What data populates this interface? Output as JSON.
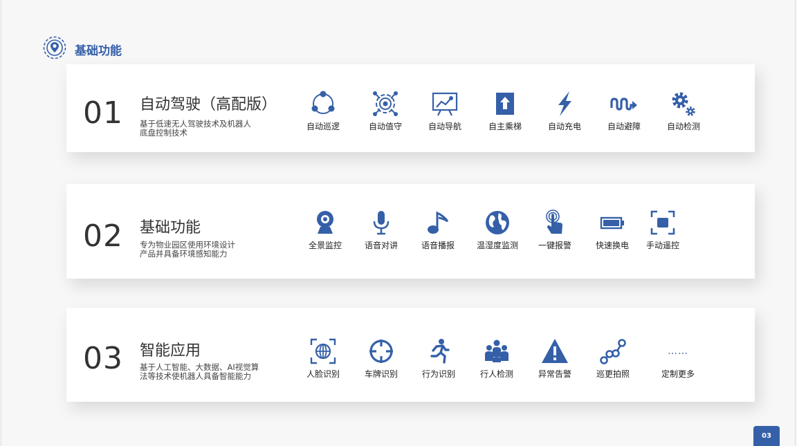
{
  "header": {
    "title": "基础功能",
    "icon": "location-target-icon"
  },
  "colors": {
    "accent": "#3560a8",
    "card_bg": "#ffffff",
    "page_bg": "#f7f7f8"
  },
  "sections": [
    {
      "num": "01",
      "title": "自动驾驶（高配版）",
      "desc_lines": [
        "基于低速无人驾驶技术及机器人",
        "底盘控制技术"
      ],
      "features": [
        {
          "label": "自动巡逻",
          "icon": "patrol-cycle-icon"
        },
        {
          "label": "自动值守",
          "icon": "guard-target-icon"
        },
        {
          "label": "自动导航",
          "icon": "navigation-screen-icon"
        },
        {
          "label": "自主乘梯",
          "icon": "elevator-icon"
        },
        {
          "label": "自动充电",
          "icon": "lightning-icon"
        },
        {
          "label": "自动避障",
          "icon": "obstacle-avoid-icon"
        },
        {
          "label": "自动检测",
          "icon": "gears-icon"
        }
      ]
    },
    {
      "num": "02",
      "title": "基础功能",
      "desc_lines": [
        "专为物业园区使用环境设计",
        "产品并具备环境感知能力"
      ],
      "features": [
        {
          "label": "全景监控",
          "icon": "webcam-icon"
        },
        {
          "label": "语音对讲",
          "icon": "microphone-icon"
        },
        {
          "label": "语音播报",
          "icon": "music-note-icon"
        },
        {
          "label": "温湿度监测",
          "icon": "globe-icon"
        },
        {
          "label": "一键报警",
          "icon": "touch-button-icon"
        },
        {
          "label": "快速换电",
          "icon": "battery-icon"
        },
        {
          "label": "手动遥控",
          "icon": "remote-frame-icon"
        }
      ]
    },
    {
      "num": "03",
      "title": "智能应用",
      "desc_lines": [
        "基于人工智能、大数据、AI视觉算",
        "法等技术使机器人具备智能能力"
      ],
      "features": [
        {
          "label": "人脸识别",
          "icon": "face-scan-icon"
        },
        {
          "label": "车牌识别",
          "icon": "crosshair-icon"
        },
        {
          "label": "行为识别",
          "icon": "running-person-icon"
        },
        {
          "label": "行人检测",
          "icon": "people-group-icon"
        },
        {
          "label": "异常告警",
          "icon": "warning-icon"
        },
        {
          "label": "巡更拍照",
          "icon": "route-points-icon"
        },
        {
          "label": "定制更多",
          "icon": "more-dots-icon",
          "dots": "……"
        }
      ]
    }
  ],
  "page_number": "03"
}
